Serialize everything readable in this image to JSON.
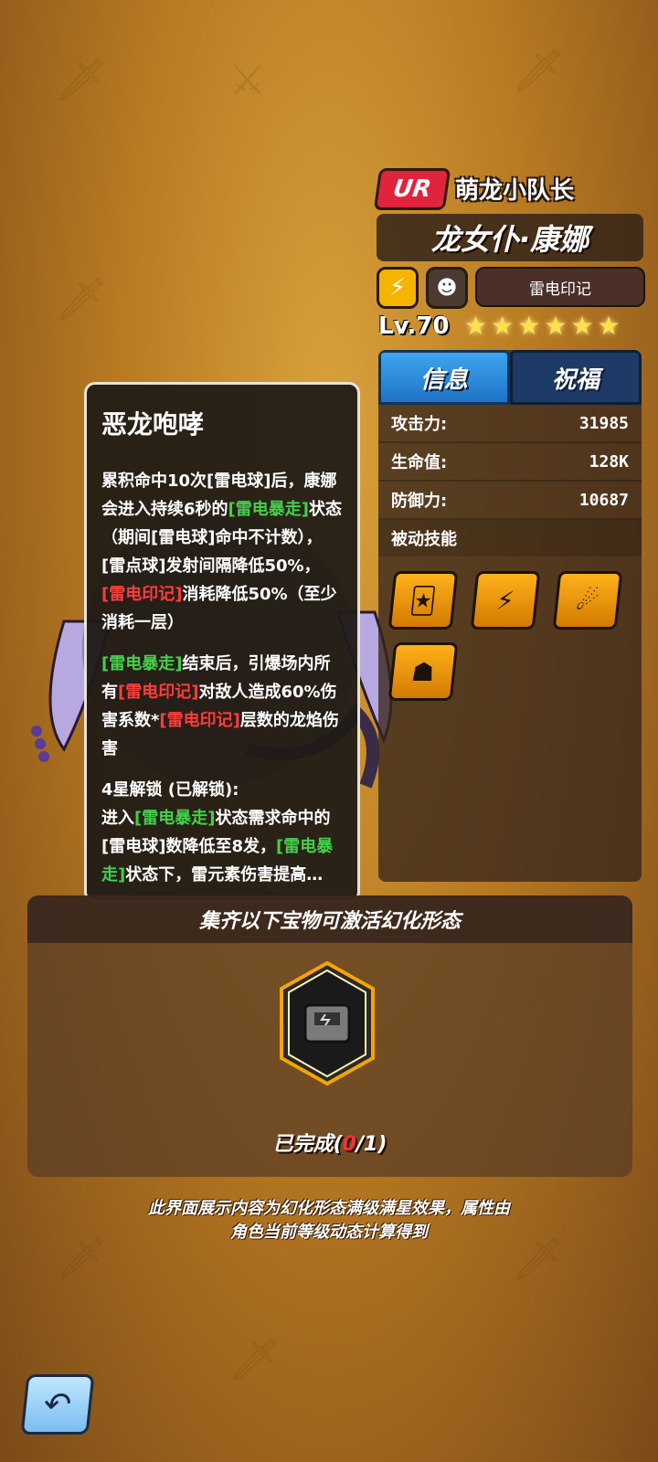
{
  "header": {
    "rarity": "UR",
    "subtitle": "萌龙小队长",
    "name": "龙女仆·康娜",
    "mark_tag": "雷电印记",
    "level": "Lv.70",
    "stars": [
      "★",
      "★",
      "★",
      "★",
      "★",
      "★"
    ]
  },
  "tabs": [
    {
      "label": "信息",
      "active": true
    },
    {
      "label": "祝福",
      "active": false
    }
  ],
  "stats": [
    {
      "label": "攻击力:",
      "value": "31985"
    },
    {
      "label": "生命值:",
      "value": "128K"
    },
    {
      "label": "防御力:",
      "value": "10687"
    }
  ],
  "passive": {
    "title": "被动技能",
    "skills": [
      "card-dice-icon",
      "lightning-burst-icon",
      "fire-orb-icon",
      "horned-helmet-icon"
    ]
  },
  "tooltip": {
    "title": "恶龙咆哮",
    "p1": [
      "累积命中10次[雷电球]后，康娜会进入持续6秒的",
      "[雷电暴走]",
      "状态（期间[雷电球]命中不计数），[雷点球]发射间隔降低50%，",
      "[雷电印记]",
      "消耗降低50%（至少消耗一层）"
    ],
    "p2": [
      "[雷电暴走]",
      "结束后，引爆场内所有",
      "[雷电印记]",
      "对敌人造成60%伤害系数*",
      "[雷电印记]",
      "层数的龙焰伤害"
    ],
    "p3": [
      "4星解锁 (已解锁):",
      "进入",
      "[雷电暴走]",
      "状态需求命中的[雷电球]数降低至8发，",
      "[雷电暴走]",
      "状态下，雷元素伤害提高…"
    ]
  },
  "treasure": {
    "header": "集齐以下宝物可激活幻化形态",
    "progress_prefix": "已完成(",
    "progress_done": "0",
    "progress_suffix": "/1)"
  },
  "footnote": {
    "line1": "此界面展示内容为幻化形态满级满星效果，属性由",
    "line2": "角色当前等级动态计算得到"
  },
  "colors": {
    "rarity_red": "#e0243c",
    "tab_active": "#3fa4ee",
    "tab_inactive": "#1e3a66",
    "keyword_green": "#43d04c",
    "keyword_red": "#ff3c3c",
    "skill_gold": "#ffb11a"
  },
  "back_icon": "back-arrow-icon"
}
